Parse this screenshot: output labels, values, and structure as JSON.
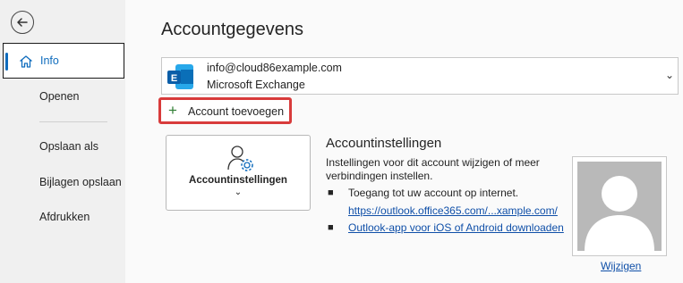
{
  "sidebar": {
    "back_icon": "arrow-left-icon",
    "items": [
      {
        "label": "Info",
        "icon": "home-icon",
        "active": true
      },
      {
        "label": "Openen"
      },
      {
        "label": "Opslaan als"
      },
      {
        "label": "Bijlagen opslaan"
      },
      {
        "label": "Afdrukken"
      }
    ]
  },
  "main": {
    "title": "Accountgegevens",
    "account": {
      "email": "info@cloud86example.com",
      "type": "Microsoft Exchange",
      "logo_icon": "exchange-logo-icon"
    },
    "add_account_label": "Account toevoegen",
    "settings_tile": {
      "label": "Accountinstellingen",
      "icon": "person-gear-icon"
    },
    "settings_section": {
      "title": "Accountinstellingen",
      "description": "Instellingen voor dit account wijzigen of meer verbindingen instellen.",
      "bullet1_text": "Toegang tot uw account op internet.",
      "bullet1_link": "https://outlook.office365.com/...xample.com/",
      "bullet2_link": "Outlook-app voor iOS of Android downloaden"
    },
    "profile": {
      "change_label": "Wijzigen"
    }
  },
  "colors": {
    "accent": "#0f6cbd",
    "highlight_border": "#d83b3b",
    "link": "#0f4fa8",
    "sidebar_bg": "#f0f0f0"
  }
}
